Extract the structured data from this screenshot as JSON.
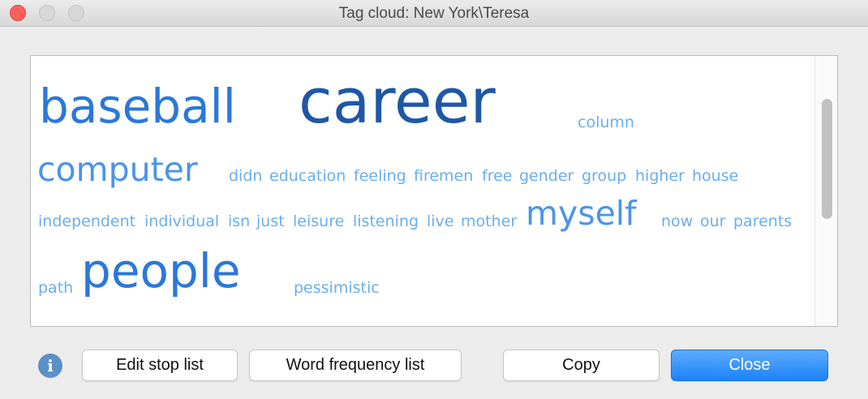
{
  "window": {
    "title": "Tag cloud: New York\\Teresa"
  },
  "cloud": {
    "words": [
      {
        "text": "baseball",
        "size": "large"
      },
      {
        "text": "career",
        "size": "largest"
      },
      {
        "text": "column",
        "size": "small"
      },
      {
        "text": "computer",
        "size": "medium"
      },
      {
        "text": "didn",
        "size": "small"
      },
      {
        "text": "education",
        "size": "small"
      },
      {
        "text": "feeling",
        "size": "small"
      },
      {
        "text": "firemen",
        "size": "small"
      },
      {
        "text": "free",
        "size": "small"
      },
      {
        "text": "gender",
        "size": "small"
      },
      {
        "text": "group",
        "size": "small"
      },
      {
        "text": "higher",
        "size": "small"
      },
      {
        "text": "house",
        "size": "small"
      },
      {
        "text": "independent",
        "size": "small"
      },
      {
        "text": "individual",
        "size": "small"
      },
      {
        "text": "isn",
        "size": "small"
      },
      {
        "text": "just",
        "size": "small"
      },
      {
        "text": "leisure",
        "size": "small"
      },
      {
        "text": "listening",
        "size": "small"
      },
      {
        "text": "live",
        "size": "small"
      },
      {
        "text": "mother",
        "size": "small"
      },
      {
        "text": "myself",
        "size": "medium"
      },
      {
        "text": "now",
        "size": "small"
      },
      {
        "text": "our",
        "size": "small"
      },
      {
        "text": "parents",
        "size": "small"
      },
      {
        "text": "path",
        "size": "small"
      },
      {
        "text": "people",
        "size": "extra-large"
      },
      {
        "text": "pessimistic",
        "size": "small"
      }
    ]
  },
  "buttons": {
    "edit_stop_list": "Edit stop list",
    "word_frequency_list": "Word frequency list",
    "copy": "Copy",
    "close": "Close"
  },
  "icons": {
    "info": "i"
  },
  "colors": {
    "close_button": "#1a82fb",
    "word_darkest": "#1f57a6",
    "word_light": "#6aaeef"
  }
}
